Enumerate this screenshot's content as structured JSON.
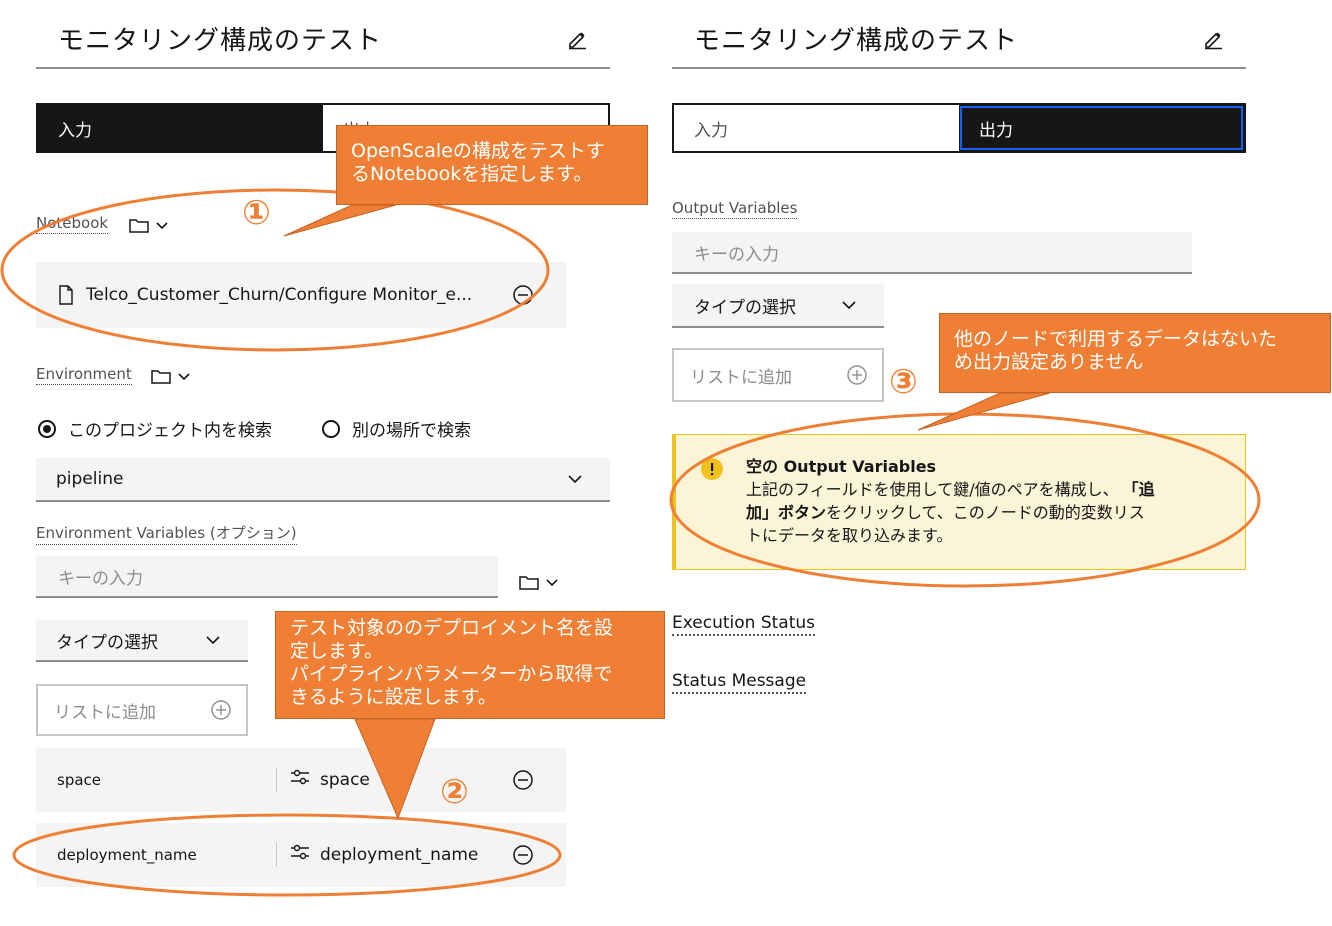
{
  "left": {
    "title": "モニタリング構成のテスト",
    "tabs": {
      "input": "入力",
      "output": "出力"
    },
    "notebook": {
      "label": "Notebook",
      "file": "Telco_Customer_Churn/Configure Monitor_e..."
    },
    "environment": {
      "label": "Environment",
      "radio_this_project": "このプロジェクト内を検索",
      "radio_other_place": "別の場所で検索",
      "selected": "pipeline"
    },
    "env_vars": {
      "label": "Environment Variables (オプション)",
      "key_placeholder": "キーの入力",
      "type_select": "タイプの選択",
      "add_to_list": "リストに追加",
      "rows": [
        {
          "key": "space",
          "value": "space"
        },
        {
          "key": "deployment_name",
          "value": "deployment_name"
        }
      ]
    }
  },
  "right": {
    "title": "モニタリング構成のテスト",
    "tabs": {
      "input": "入力",
      "output": "出力"
    },
    "output_vars": {
      "label": "Output Variables",
      "key_placeholder": "キーの入力",
      "type_select": "タイプの選択",
      "add_to_list": "リストに追加"
    },
    "notice": {
      "title": "空の Output Variables",
      "line1_pre": "上記のフィールドを使用して鍵/値のペアを構成し、",
      "line1_bold": "「追",
      "line2_bold": "加」ボタン",
      "line2_post": "をクリックして、このノードの動的変数リス",
      "line3": "トにデータを取り込みます。"
    },
    "execution_status": "Execution Status",
    "status_message": "Status Message"
  },
  "annotations": {
    "callout1_line1": "OpenScaleの構成をテストす",
    "callout1_line2": "るNotebookを指定します。",
    "callout2_line1": "テスト対象ののデプロイメント名を設",
    "callout2_line2": "定します。",
    "callout2_line3": "パイプラインパラメーターから取得で",
    "callout2_line4": "きるように設定します。",
    "callout3_line1": "他のノードで利用するデータはないた",
    "callout3_line2": "め出力設定ありません",
    "marker1": "①",
    "marker2": "②",
    "marker3": "③"
  },
  "colors": {
    "accent_orange": "#ee7f35",
    "dark": "#161616",
    "focus_blue": "#0f62fe",
    "warning_yellow": "#f1c21b"
  },
  "icons": [
    "edit-icon",
    "folder-icon",
    "chevron-down-icon",
    "document-icon",
    "subtract-circle-icon",
    "add-circle-icon",
    "settings-adjust-icon",
    "warning-icon"
  ]
}
